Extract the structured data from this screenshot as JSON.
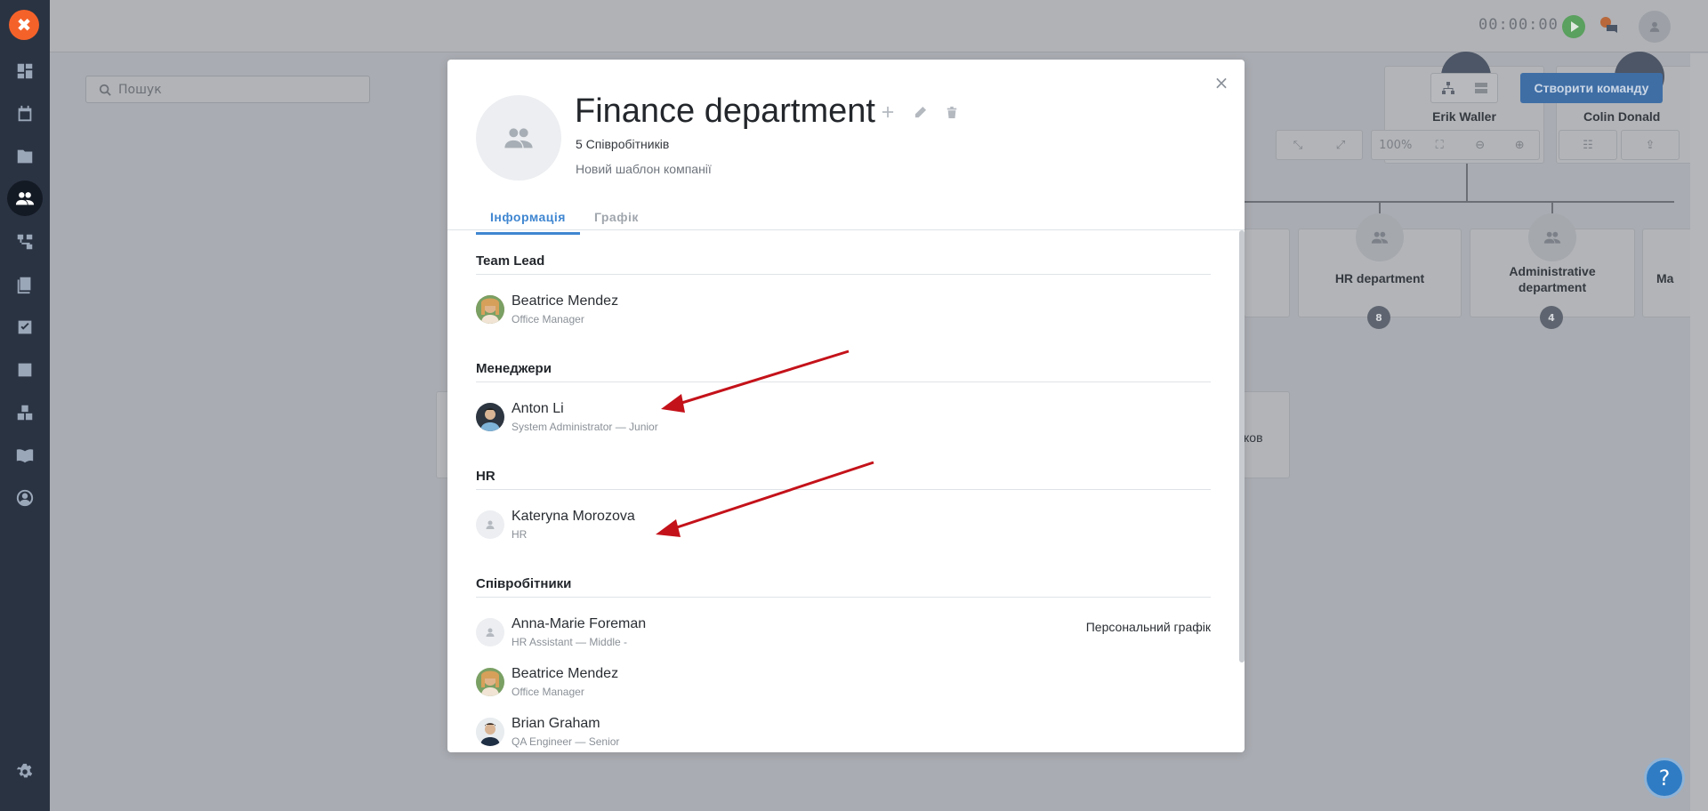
{
  "app": {
    "timer": "00:00:00"
  },
  "search": {
    "placeholder": "Пошук"
  },
  "toolbar": {
    "create_team": "Створити команду",
    "zoom": "100%"
  },
  "org": {
    "people": [
      {
        "name": "Erik Waller"
      },
      {
        "name": "Colin Donald"
      }
    ],
    "departments": [
      {
        "name": "HR department",
        "count": "8"
      },
      {
        "name": "Administrative department",
        "count": "4"
      },
      {
        "name": "Ma"
      }
    ],
    "partial_text": "ков"
  },
  "modal": {
    "title": "Finance department",
    "employee_count": "5 Співробітників",
    "template": "Новий шаблон компанії",
    "tabs": [
      {
        "label": "Інформація"
      },
      {
        "label": "Графік"
      }
    ],
    "sections": {
      "team_lead": {
        "title": "Team Lead",
        "members": [
          {
            "name": "Beatrice Mendez",
            "role": "Office Manager"
          }
        ]
      },
      "managers": {
        "title": "Менеджери",
        "members": [
          {
            "name": "Anton Li",
            "role": "System Administrator — Junior"
          }
        ]
      },
      "hr": {
        "title": "HR",
        "members": [
          {
            "name": "Kateryna Morozova",
            "role": "HR"
          }
        ]
      },
      "employees": {
        "title": "Співробітники",
        "members": [
          {
            "name": "Anna-Marie Foreman",
            "role": "HR Assistant — Middle -",
            "schedule": "Персональний графік"
          },
          {
            "name": "Beatrice Mendez",
            "role": "Office Manager"
          },
          {
            "name": "Brian Graham",
            "role": "QA Engineer — Senior"
          }
        ]
      }
    }
  },
  "colors": {
    "accent": "#3f86d1",
    "logo": "#f4622a",
    "annotation_arrow": "#c4121a"
  }
}
